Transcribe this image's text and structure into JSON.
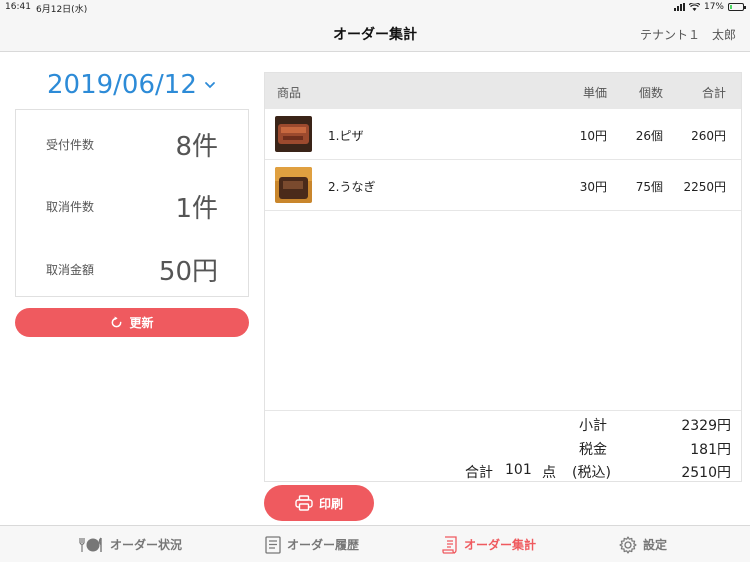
{
  "status_bar": {
    "time": "16:41",
    "date": "6月12日(水)",
    "battery": "17%",
    "battery_level": 0.17
  },
  "header": {
    "title": "オーダー集計",
    "tenant": "テナント１",
    "user": "太郎"
  },
  "date_picker": {
    "value": "2019/06/12"
  },
  "summary": [
    {
      "label": "受付件数",
      "value": "8件"
    },
    {
      "label": "取消件数",
      "value": "1件"
    },
    {
      "label": "取消金額",
      "value": "50円"
    }
  ],
  "refresh_label": "更新",
  "table": {
    "columns": {
      "name": "商品",
      "price": "単価",
      "qty": "個数",
      "total": "合計"
    },
    "rows": [
      {
        "name": "1.ピザ",
        "price": "10円",
        "qty": "26個",
        "total": "260円",
        "thumb_color": "#8b3a2a"
      },
      {
        "name": "2.うなぎ",
        "price": "30円",
        "qty": "75個",
        "total": "2250円",
        "thumb_color": "#5a3522"
      }
    ]
  },
  "totals": {
    "subtotal_label": "小計",
    "subtotal": "2329円",
    "tax_label": "税金",
    "tax": "181円",
    "grand_label": "合計",
    "grand_count": "101",
    "grand_unit": "点",
    "tax_incl": "(税込)",
    "grand": "2510円"
  },
  "print_label": "印刷",
  "tabs": [
    {
      "label": "オーダー状況",
      "icon": "fork-plate-icon"
    },
    {
      "label": "オーダー履歴",
      "icon": "document-icon"
    },
    {
      "label": "オーダー集計",
      "icon": "receipt-icon",
      "active": true
    },
    {
      "label": "設定",
      "icon": "gear-icon"
    }
  ],
  "colors": {
    "accent": "#ef5a5f",
    "date": "#2d8bd7"
  }
}
